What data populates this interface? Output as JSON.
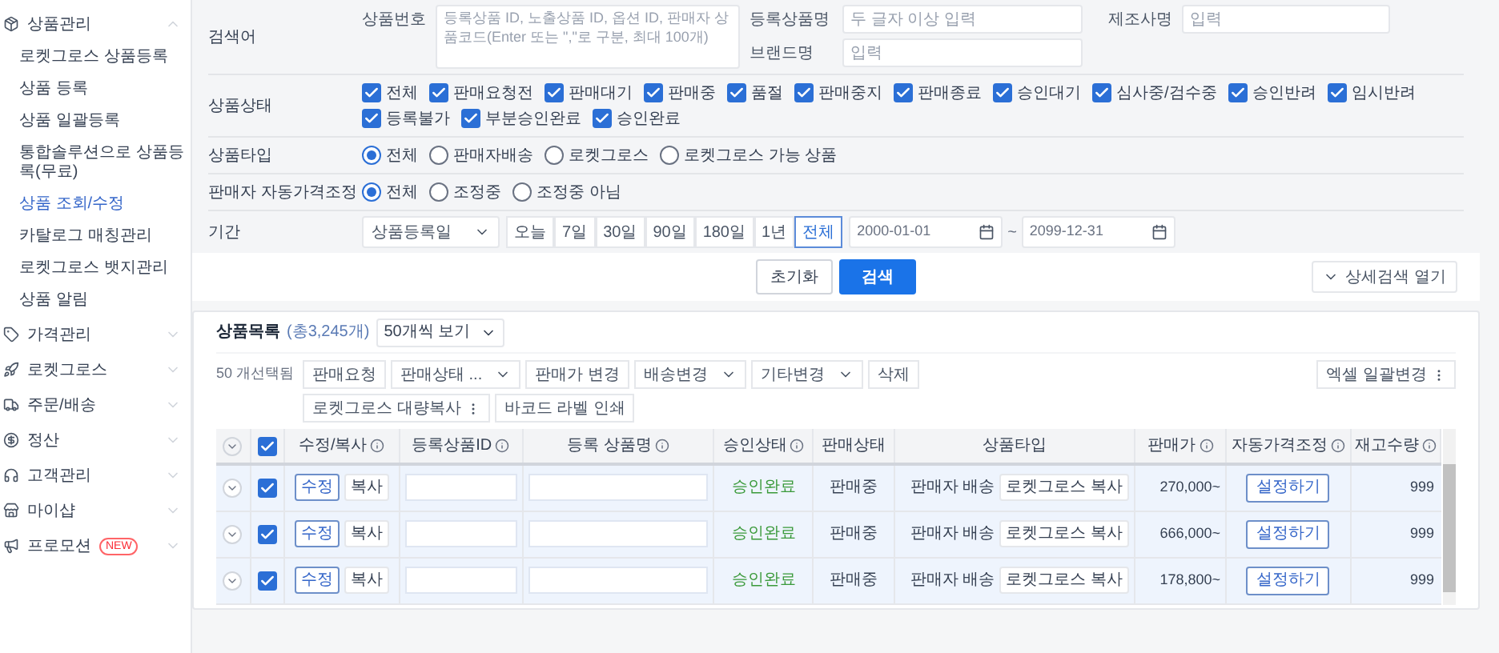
{
  "sidebar": {
    "groups": [
      {
        "label": "상품관리",
        "expanded": true,
        "children": [
          {
            "label": "로켓그로스 상품등록",
            "selected": false
          },
          {
            "label": "상품 등록",
            "selected": false
          },
          {
            "label": "상품 일괄등록",
            "selected": false
          },
          {
            "label": "통합솔루션으로 상품등록(무료)",
            "selected": false
          },
          {
            "label": "상품 조회/수정",
            "selected": true
          },
          {
            "label": "카탈로그 매칭관리",
            "selected": false
          },
          {
            "label": "로켓그로스 뱃지관리",
            "selected": false
          },
          {
            "label": "상품 알림",
            "selected": false
          }
        ]
      },
      {
        "label": "가격관리",
        "expanded": false
      },
      {
        "label": "로켓그로스",
        "expanded": false
      },
      {
        "label": "주문/배송",
        "expanded": false
      },
      {
        "label": "정산",
        "expanded": false
      },
      {
        "label": "고객관리",
        "expanded": false
      },
      {
        "label": "마이샵",
        "expanded": false
      },
      {
        "label": "프로모션",
        "expanded": false,
        "badge": "NEW"
      }
    ]
  },
  "search": {
    "keyword_label": "검색어",
    "fields": [
      {
        "label": "상품번호",
        "placeholder": "등록상품 ID, 노출상품 ID, 옵션 ID, 판매자 상품코드(Enter 또는 \",\"로 구분, 최대 100개)"
      },
      {
        "label": "등록상품명",
        "placeholder": "두 글자 이상 입력"
      },
      {
        "label": "제조사명",
        "placeholder": "입력"
      },
      {
        "label": "브랜드명",
        "placeholder": "입력"
      }
    ],
    "status": {
      "label": "상품상태",
      "options": [
        {
          "label": "전체",
          "checked": true
        },
        {
          "label": "판매요청전",
          "checked": true
        },
        {
          "label": "판매대기",
          "checked": true
        },
        {
          "label": "판매중",
          "checked": true
        },
        {
          "label": "품절",
          "checked": true
        },
        {
          "label": "판매중지",
          "checked": true
        },
        {
          "label": "판매종료",
          "checked": true
        },
        {
          "label": "승인대기",
          "checked": true
        },
        {
          "label": "심사중/검수중",
          "checked": true
        },
        {
          "label": "승인반려",
          "checked": true
        },
        {
          "label": "임시반려",
          "checked": true
        },
        {
          "label": "등록불가",
          "checked": true
        },
        {
          "label": "부분승인완료",
          "checked": true
        },
        {
          "label": "승인완료",
          "checked": true
        }
      ]
    },
    "product_type": {
      "label": "상품타입",
      "options": [
        {
          "label": "전체",
          "selected": true
        },
        {
          "label": "판매자배송",
          "selected": false
        },
        {
          "label": "로켓그로스",
          "selected": false
        },
        {
          "label": "로켓그로스 가능 상품",
          "selected": false
        }
      ]
    },
    "auto_price": {
      "label": "판매자 자동가격조정",
      "options": [
        {
          "label": "전체",
          "selected": true
        },
        {
          "label": "조정중",
          "selected": false
        },
        {
          "label": "조정중 아님",
          "selected": false
        }
      ]
    },
    "period": {
      "label": "기간",
      "select": "상품등록일",
      "ranges": [
        {
          "label": "오늘",
          "selected": false
        },
        {
          "label": "7일",
          "selected": false
        },
        {
          "label": "30일",
          "selected": false
        },
        {
          "label": "90일",
          "selected": false
        },
        {
          "label": "180일",
          "selected": false
        },
        {
          "label": "1년",
          "selected": false
        },
        {
          "label": "전체",
          "selected": true
        }
      ],
      "start": "2000-01-01",
      "separator": "~",
      "end": "2099-12-31"
    },
    "reset_button": "초기화",
    "search_button": "검색",
    "detail_button": "상세검색 열기"
  },
  "list": {
    "title": "상품목록",
    "count": "(총3,245개)",
    "page_size": "50개씩 보기",
    "selected_count": "50 개선택됨",
    "action_rows": [
      [
        {
          "label": "판매요청",
          "kind": "button"
        },
        {
          "label": "판매상태 ...",
          "kind": "dropdown"
        },
        {
          "label": "판매가 변경",
          "kind": "button"
        },
        {
          "label": "배송변경",
          "kind": "dropdown"
        },
        {
          "label": "기타변경",
          "kind": "dropdown"
        },
        {
          "label": "삭제",
          "kind": "button"
        }
      ],
      [
        {
          "label": "로켓그로스 대량복사",
          "kind": "menu"
        },
        {
          "label": "바코드 라벨 인쇄",
          "kind": "button"
        }
      ]
    ],
    "excel_button": "엑셀 일괄변경",
    "table": {
      "all_checked": true,
      "columns": [
        {
          "label": "수정/복사",
          "info": true
        },
        {
          "label": "등록상품ID",
          "info": true
        },
        {
          "label": "등록 상품명",
          "info": true
        },
        {
          "label": "승인상태",
          "info": true
        },
        {
          "label": "판매상태",
          "info": false
        },
        {
          "label": "상품타입",
          "info": false
        },
        {
          "label": "판매가",
          "info": true
        },
        {
          "label": "자동가격조정",
          "info": true
        },
        {
          "label": "재고수량",
          "info": true
        }
      ],
      "rows": [
        {
          "checked": true,
          "edit": "수정",
          "copy": "복사",
          "approval": "승인완료",
          "sale_status": "판매중",
          "delivery": "판매자 배송",
          "growth_copy": "로켓그로스 복사",
          "price": "270,000~",
          "auto_price": "설정하기",
          "stock": "999"
        },
        {
          "checked": true,
          "edit": "수정",
          "copy": "복사",
          "approval": "승인완료",
          "sale_status": "판매중",
          "delivery": "판매자 배송",
          "growth_copy": "로켓그로스 복사",
          "price": "666,000~",
          "auto_price": "설정하기",
          "stock": "999"
        },
        {
          "checked": true,
          "edit": "수정",
          "copy": "복사",
          "approval": "승인완료",
          "sale_status": "판매중",
          "delivery": "판매자 배송",
          "growth_copy": "로켓그로스 복사",
          "price": "178,800~",
          "auto_price": "설정하기",
          "stock": "999"
        }
      ]
    }
  }
}
